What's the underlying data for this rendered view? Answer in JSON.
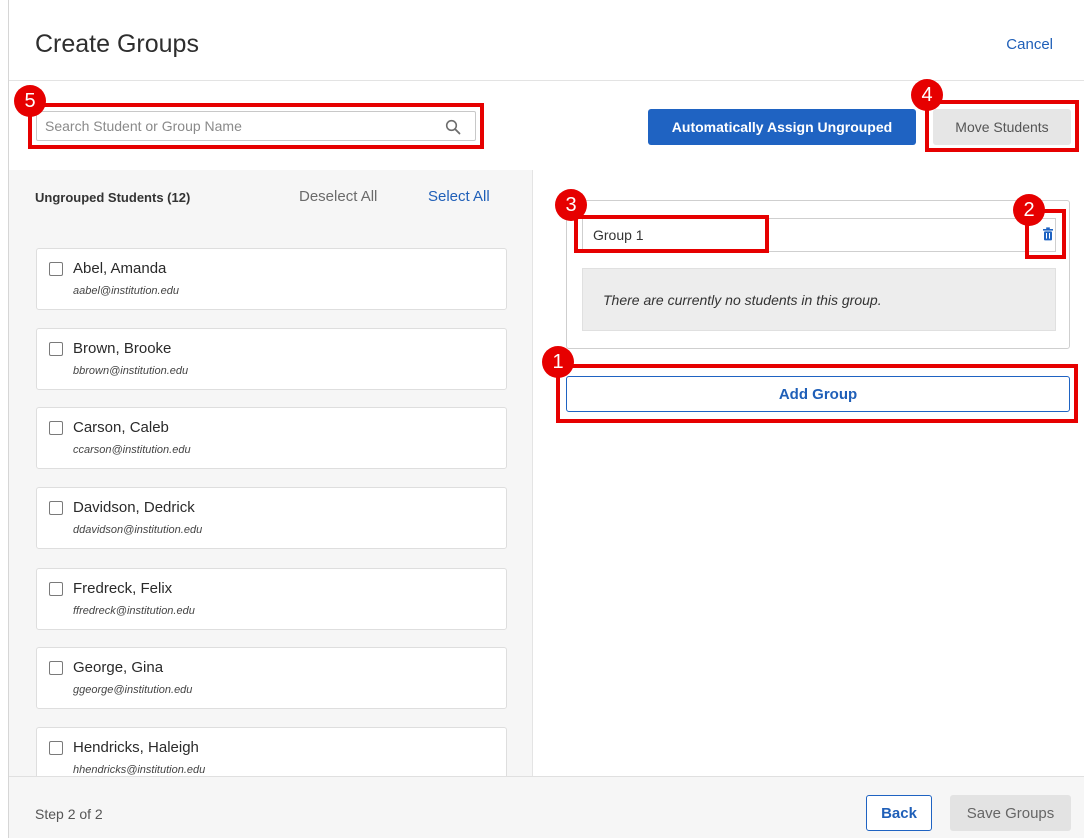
{
  "header": {
    "title": "Create Groups",
    "cancel_label": "Cancel"
  },
  "search": {
    "placeholder": "Search Student or Group Name",
    "value": ""
  },
  "toolbar": {
    "auto_assign_label": "Automatically Assign Ungrouped",
    "move_students_label": "Move Students"
  },
  "ungrouped": {
    "title": "Ungrouped Students (12)",
    "deselect_all_label": "Deselect All",
    "select_all_label": "Select All",
    "students": [
      {
        "name": "Abel, Amanda",
        "email": "aabel@institution.edu",
        "checked": false
      },
      {
        "name": "Brown, Brooke",
        "email": "bbrown@institution.edu",
        "checked": false
      },
      {
        "name": "Carson, Caleb",
        "email": "ccarson@institution.edu",
        "checked": false
      },
      {
        "name": "Davidson, Dedrick",
        "email": "ddavidson@institution.edu",
        "checked": false
      },
      {
        "name": "Fredreck, Felix",
        "email": "ffredreck@institution.edu",
        "checked": false
      },
      {
        "name": "George, Gina",
        "email": "ggeorge@institution.edu",
        "checked": false
      },
      {
        "name": "Hendricks, Haleigh",
        "email": "hhendricks@institution.edu",
        "checked": false
      }
    ]
  },
  "groups": [
    {
      "name": "Group 1",
      "empty_message": "There are currently no students in this group."
    }
  ],
  "add_group_label": "Add Group",
  "footer": {
    "step_text": "Step 2 of 2",
    "back_label": "Back",
    "save_label": "Save Groups"
  },
  "annotations": [
    "1",
    "2",
    "3",
    "4",
    "5"
  ],
  "colors": {
    "primary": "#1f63c2",
    "link": "#1f5fb8",
    "annotation": "#e60000",
    "panel_bg": "#f6f6f6"
  }
}
